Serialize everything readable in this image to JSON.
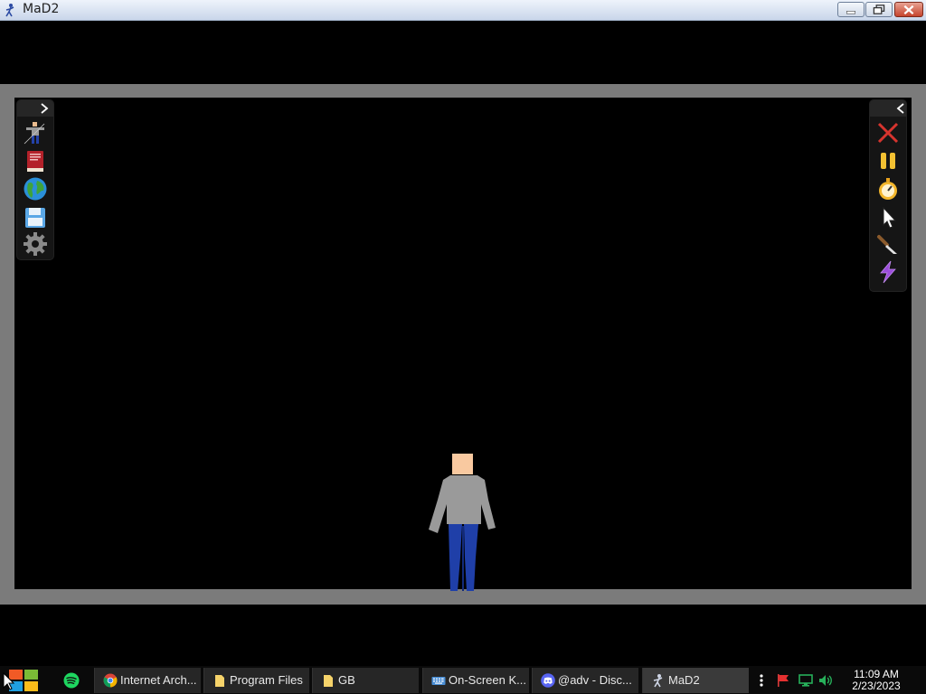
{
  "window": {
    "title": "MaD2",
    "icon": "mad2-figure-icon"
  },
  "left_toolbar": {
    "tools": [
      "character-pose-icon",
      "book-icon",
      "globe-icon",
      "save-disk-icon",
      "settings-gear-icon"
    ]
  },
  "right_toolbar": {
    "tools": [
      "close-x-icon",
      "pause-icon",
      "stopwatch-icon",
      "cursor-arrow-icon",
      "knife-icon",
      "lightning-icon"
    ]
  },
  "taskbar": {
    "items": [
      {
        "label": "Internet Arch...",
        "icon": "chrome-icon"
      },
      {
        "label": "Program Files",
        "icon": "folder-icon"
      },
      {
        "label": "GB",
        "icon": "folder-icon"
      },
      {
        "label": "On-Screen K...",
        "icon": "keyboard-icon"
      },
      {
        "label": "@adv - Disc...",
        "icon": "discord-icon"
      },
      {
        "label": "MaD2",
        "icon": "mad2-figure-icon"
      }
    ],
    "clock": {
      "time": "11:09 AM",
      "date": "2/23/2023"
    }
  },
  "colors": {
    "frame": "#7b7b7b",
    "stage": "#000000",
    "shirt": "#9a9a9a",
    "pants": "#1f3fa8",
    "skin": "#f9c9a0"
  }
}
